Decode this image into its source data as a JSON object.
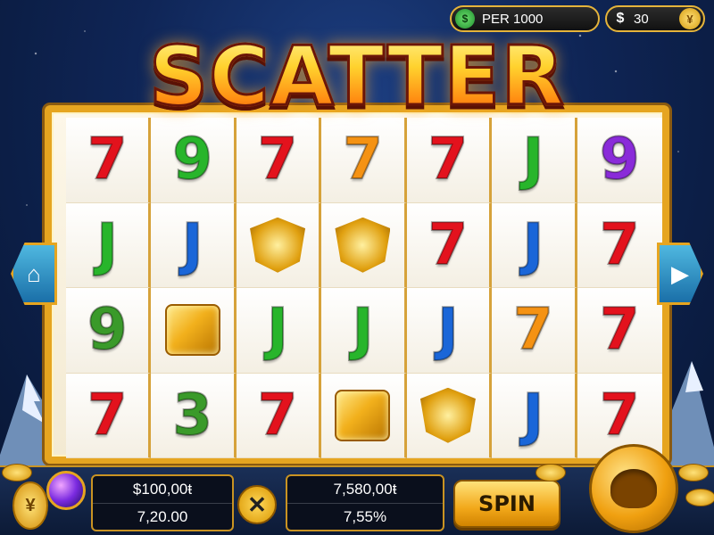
{
  "top_bar": {
    "per_icon": "dollar-coin-icon",
    "per_label": "PER 1000",
    "balance_symbol": "$",
    "balance_value": "30",
    "coin_icon_label": "¥"
  },
  "title": "SCATTER",
  "reels": [
    [
      {
        "t": "7",
        "c": "red"
      },
      {
        "t": "9",
        "c": "green"
      },
      {
        "t": "7",
        "c": "red"
      },
      {
        "t": "7",
        "c": "orange"
      },
      {
        "t": "7",
        "c": "red"
      },
      {
        "t": "J",
        "c": "green"
      },
      {
        "t": "9",
        "c": "purple"
      }
    ],
    [
      {
        "t": "J",
        "c": "green"
      },
      {
        "t": "J",
        "c": "blue"
      },
      {
        "t": "crest",
        "c": "gold"
      },
      {
        "t": "crest",
        "c": "gold"
      },
      {
        "t": "7",
        "c": "red"
      },
      {
        "t": "J",
        "c": "blue"
      },
      {
        "t": "7",
        "c": "red"
      }
    ],
    [
      {
        "t": "9",
        "c": "dkgreen"
      },
      {
        "t": "block",
        "c": "gold"
      },
      {
        "t": "J",
        "c": "green"
      },
      {
        "t": "J",
        "c": "green"
      },
      {
        "t": "J",
        "c": "blue"
      },
      {
        "t": "7",
        "c": "orange"
      },
      {
        "t": "7",
        "c": "red"
      }
    ],
    [
      {
        "t": "7",
        "c": "red"
      },
      {
        "t": "3",
        "c": "dkgreen"
      },
      {
        "t": "7",
        "c": "red"
      },
      {
        "t": "block",
        "c": "gold"
      },
      {
        "t": "crest",
        "c": "gold"
      },
      {
        "t": "J",
        "c": "blue"
      },
      {
        "t": "7",
        "c": "red"
      }
    ]
  ],
  "controls": {
    "left_arrow_icon": "home-icon",
    "right_arrow_icon": "play-arrow-icon",
    "bet_total": "$100,00ŧ",
    "bet_line": "7,20.00",
    "x_label": "✕",
    "win_total": "7,580,00ŧ",
    "win_pct": "7,55%",
    "spin_label": "SPIN",
    "coin_left_label": "¥"
  }
}
